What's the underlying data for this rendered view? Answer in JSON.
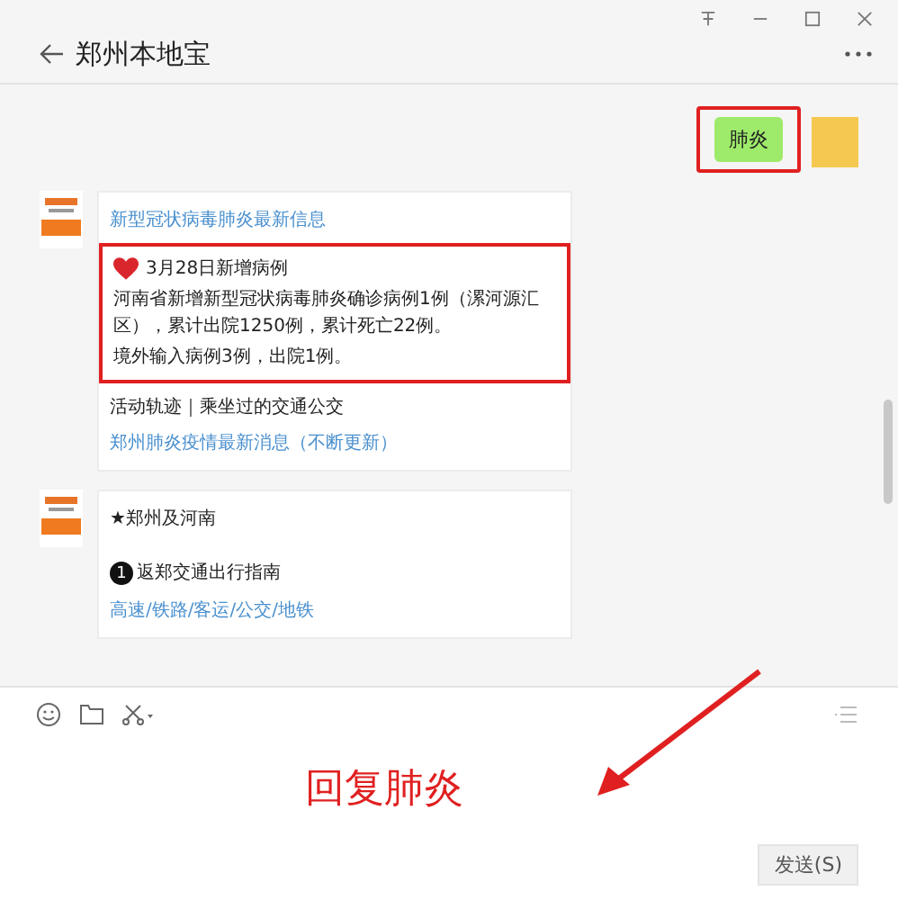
{
  "window": {
    "title": "郑州本地宝"
  },
  "messages": [
    {
      "kind": "outgoing",
      "text": "肺炎",
      "highlighted": true
    },
    {
      "kind": "card",
      "blocks": [
        {
          "kind": "link",
          "text": "新型冠状病毒肺炎最新信息"
        },
        {
          "kind": "highlight",
          "heading": "3月28日新增病例",
          "lines": [
            "河南省新增新型冠状病毒肺炎确诊病例1例（漯河源汇区），累计出院1250例，累计死亡22例。",
            "境外输入病例3例，出院1例。"
          ]
        },
        {
          "kind": "text",
          "text": "活动轨迹｜乘坐过的交通公交"
        },
        {
          "kind": "link",
          "text": "郑州肺炎疫情最新消息（不断更新）"
        }
      ]
    },
    {
      "kind": "card",
      "blocks": [
        {
          "kind": "text",
          "text": "★郑州及河南"
        },
        {
          "kind": "numbered",
          "number": "1",
          "text": "返郑交通出行指南"
        },
        {
          "kind": "link",
          "text": "高速/铁路/客运/公交/地铁"
        }
      ]
    }
  ],
  "composer": {
    "annotation": "回复肺炎",
    "send": "发送(S)"
  }
}
